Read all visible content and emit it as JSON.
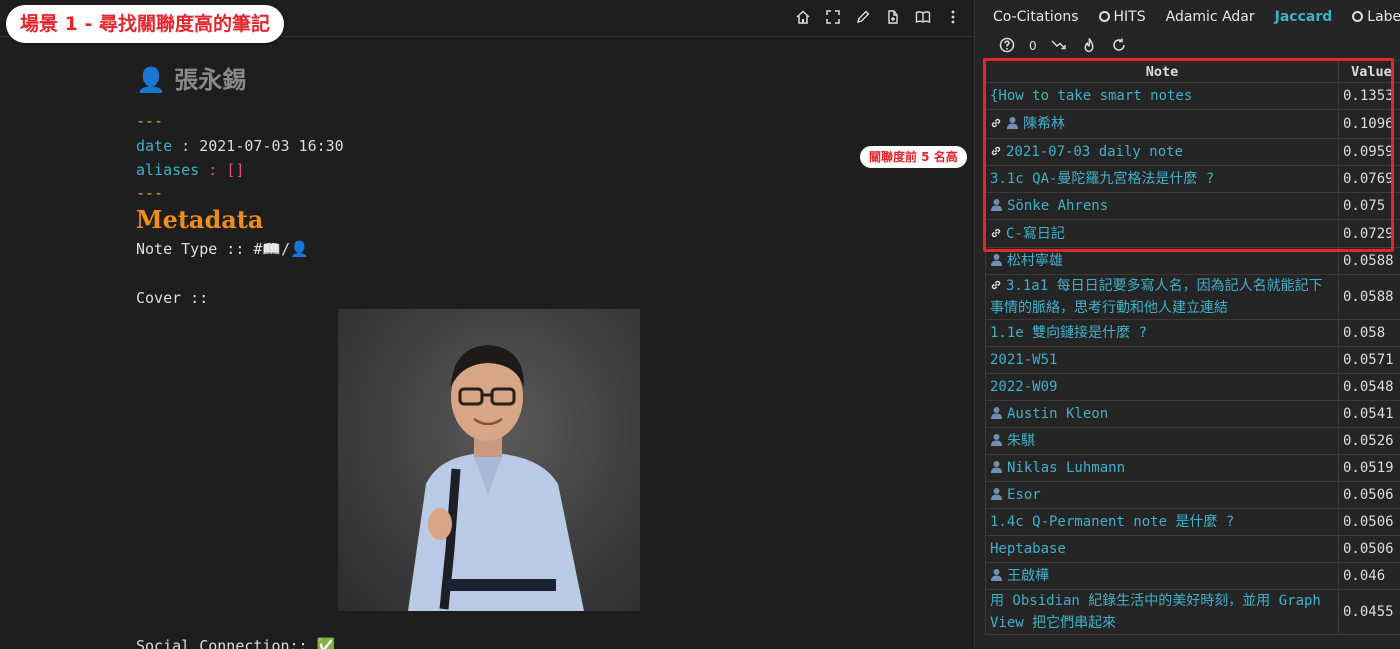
{
  "scene_badge": "場景 1 - 尋找關聯度高的筆記",
  "editor": {
    "title": "張永錫",
    "title_icon": "👤",
    "frontmatter": {
      "dash": "---",
      "date_key": "date",
      "date_value": "2021-07-03 16:30",
      "aliases_key": "aliases",
      "aliases_value": "[]"
    },
    "metadata_heading": "Metadata",
    "note_type_label": "Note Type :: #📖/👤",
    "cover_label": "Cover ::",
    "social_label": "Social Connection:: ✅",
    "actions": [
      "home-icon",
      "fullscreen-icon",
      "edit-pen-icon",
      "export-icon",
      "reading-mode-icon",
      "more-options-icon"
    ]
  },
  "rank_note": "關聯度前 5 名高",
  "analysis": {
    "tabs": [
      {
        "label": "Co-Citations",
        "icon": ""
      },
      {
        "label": "HITS",
        "icon": "github-icon"
      },
      {
        "label": "Adamic Adar",
        "icon": ""
      },
      {
        "label": "Jaccard",
        "icon": "",
        "active": true
      },
      {
        "label": "Label P",
        "icon": "github-icon"
      }
    ],
    "tools": {
      "help_icon": "help-circle-icon",
      "count": "0",
      "trend_icon": "trending-down-icon",
      "flame_icon": "flame-icon",
      "refresh_icon": "refresh-icon"
    },
    "table": {
      "headers": [
        "Note",
        "Value"
      ],
      "rows": [
        {
          "icon": "",
          "note": "{How to take smart notes",
          "value": "0.1353"
        },
        {
          "icon": "link+person",
          "note": "陳希林",
          "value": "0.1096"
        },
        {
          "icon": "link",
          "note": "2021-07-03 daily note",
          "value": "0.0959"
        },
        {
          "icon": "",
          "note": "3.1c QA-曼陀羅九宮格法是什麼 ?",
          "value": "0.0769"
        },
        {
          "icon": "person",
          "note": "Sönke Ahrens",
          "value": "0.075"
        },
        {
          "icon": "link",
          "note": "C-寫日記",
          "value": "0.0729"
        },
        {
          "icon": "person",
          "note": "松村寧雄",
          "value": "0.0588"
        },
        {
          "icon": "link",
          "note": "3.1a1 每日日記要多寫人名，因為記人名就能記下事情的脈絡，思考行動和他人建立連結",
          "value": "0.0588"
        },
        {
          "icon": "",
          "note": "1.1e 雙向鏈接是什麼 ?",
          "value": "0.058"
        },
        {
          "icon": "",
          "note": "2021-W51",
          "value": "0.0571"
        },
        {
          "icon": "",
          "note": "2022-W09",
          "value": "0.0548"
        },
        {
          "icon": "person",
          "note": "Austin Kleon",
          "value": "0.0541"
        },
        {
          "icon": "person",
          "note": "朱騏",
          "value": "0.0526"
        },
        {
          "icon": "person",
          "note": "Niklas Luhmann",
          "value": "0.0519"
        },
        {
          "icon": "person",
          "note": "Esor",
          "value": "0.0506"
        },
        {
          "icon": "",
          "note": "1.4c Q-Permanent note 是什麼 ?",
          "value": "0.0506"
        },
        {
          "icon": "",
          "note": "Heptabase",
          "value": "0.0506"
        },
        {
          "icon": "person",
          "note": "王啟樺",
          "value": "0.046"
        },
        {
          "icon": "",
          "note": "用 Obsidian 紀錄生活中的美好時刻，並用 Graph View 把它們串起來",
          "value": "0.0455"
        }
      ]
    }
  },
  "colors": {
    "accent": "#3fb0c9",
    "highlight": "#e5262d",
    "metadata_heading": "#f08c19"
  }
}
